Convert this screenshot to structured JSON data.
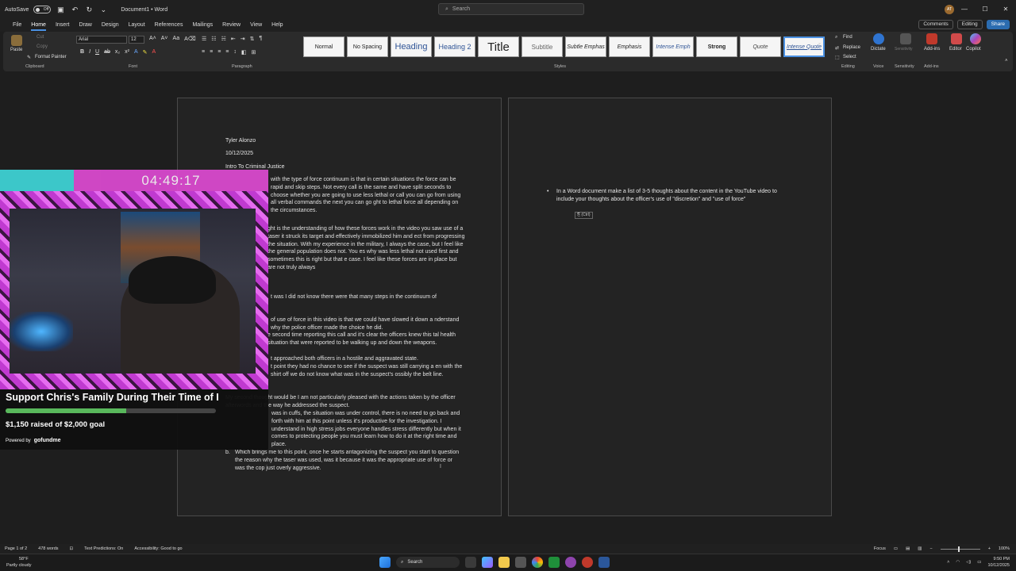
{
  "titlebar": {
    "autosave_label": "AutoSave",
    "autosave_state": "Off",
    "doc_title": "Document1 • Word",
    "search_placeholder": "Search",
    "avatar_initials": "AT"
  },
  "menu": {
    "tabs": [
      "File",
      "Home",
      "Insert",
      "Draw",
      "Design",
      "Layout",
      "References",
      "Mailings",
      "Review",
      "View",
      "Help"
    ],
    "active": "Home",
    "comments": "Comments",
    "editing": "Editing",
    "share": "Share"
  },
  "ribbon": {
    "clipboard": {
      "paste": "Paste",
      "cut": "Cut",
      "copy": "Copy",
      "format_painter": "Format Painter",
      "label": "Clipboard"
    },
    "font": {
      "name": "Arial",
      "size": "12",
      "label": "Font"
    },
    "paragraph": {
      "label": "Paragraph"
    },
    "styles": {
      "items": [
        "Normal",
        "No Spacing",
        "Heading",
        "Heading 2",
        "Title",
        "Subtitle",
        "Subtle Emphas",
        "Emphasis",
        "Intense Emph",
        "Strong",
        "Quote",
        "Intense Quote"
      ],
      "label": "Styles"
    },
    "editing": {
      "find": "Find",
      "replace": "Replace",
      "select": "Select",
      "label": "Editing"
    },
    "voice": {
      "dictate": "Dictate",
      "label": "Voice"
    },
    "sensitivity": {
      "button": "Sensitivity",
      "label": "Sensitivity"
    },
    "addins": {
      "button": "Add-ins",
      "label": "Add-ins"
    },
    "editor": "Editor",
    "copilot": "Copilot"
  },
  "page1": {
    "author": "Tyler Alonzo",
    "date": "10/12/2025",
    "course": "Intro To Criminal Justice",
    "para1": "with the type of force continuum is that in certain situations the force can be rapid and skip steps. Not every call is the same and have split seconds to choose whether you are going to use less lethal or call you can go from using all verbal commands the next you can go ght to lethal force all depending on the circumstances.",
    "para2": "ght is the understanding of how these forces work in the video you saw use of a taser it struck its target and effectively immobilized him and ect from progressing the situation. With my experience in the military, I always the case, but I feel like the general population does not. You es why was less lethal not used first and sometimes this is right but that e case. I feel like these forces are in place but are not truly always",
    "para3": "t was I did not know there were that many steps in the continuum of",
    "para4": "of use of force in this video is that we could have slowed it down a nderstand why the police officer made the choice he did.",
    "para5": "e second time reporting this call and it's clear the officers knew this tal health situation that were reported to be walking up and down the weapons.",
    "para6": "t approached both officers in a hostile and aggravated state.",
    "para7": "t point they had no chance to see if the suspect was still carrying a en with the shirt off we do not know what was in the suspect's ossibly the belt line.",
    "para8": "My second thought would be I am not particularly pleased with the actions taken by the officer afterwords and the way he addressed the suspect.",
    "para9": "was in cuffs, the situation was under control, there is no need to go back and forth with him at this point unless it's productive for the investigation. I understand in high stress jobs everyone handles stress differently but when it comes to protecting people you must learn how to do it at the right time and place.",
    "para10_letter": "b.",
    "para10": "Which brings me to this point, once he starts antagonizing the suspect you start to question the reason why the taser was used, was it because it was the appropriate use of force or was the cop just overly aggressive."
  },
  "page2": {
    "bullet": "In a Word document make a list of 3-5 thoughts about the content in the YouTube video to include your thoughts about the officer's use of \"discretion\" and \"use of force\"",
    "paste_options": "(Ctrl)"
  },
  "overlay": {
    "timer": "04:49:17",
    "support_title": "Support Chris's Family During Their Time of Loss",
    "raised_text": "$1,150 raised of $2,000 goal",
    "progress_fraction": 0.575,
    "powered_by": "Powered by",
    "brand": "gofundme"
  },
  "statusbar": {
    "page": "Page 1 of 2",
    "words": "478 words",
    "text_predictions": "Text Predictions: On",
    "accessibility": "Accessibility: Good to go",
    "focus": "Focus",
    "zoom": "100%"
  },
  "taskbar": {
    "temp": "58°F",
    "weather": "Partly cloudy",
    "search": "Search",
    "time": "9:50 PM",
    "date": "10/12/2025"
  },
  "colors": {
    "accent": "#4a90e2",
    "overlay_pink": "#e24bd6",
    "overlay_teal": "#3cc7c9",
    "progress_green": "#59b85c"
  }
}
